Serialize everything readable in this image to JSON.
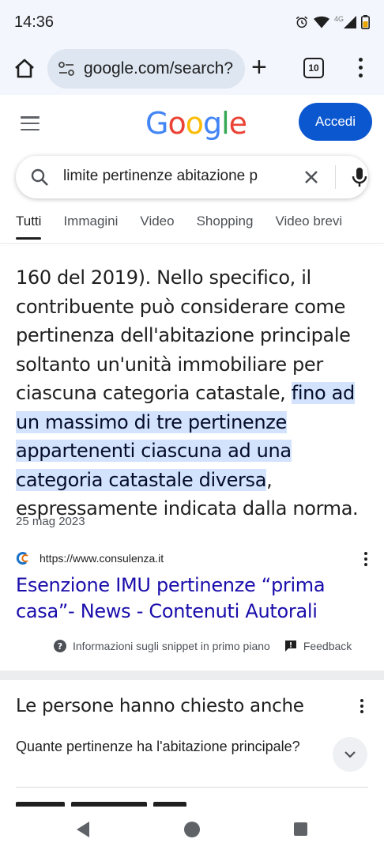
{
  "status_bar": {
    "time": "14:36",
    "network": "4G"
  },
  "browser": {
    "url": "google.com/search?",
    "tab_count": "10"
  },
  "header": {
    "logo": "Google",
    "signin_label": "Accedi"
  },
  "search": {
    "query": "limite pertinenze abitazione p"
  },
  "tabs": [
    "Tutti",
    "Immagini",
    "Video",
    "Shopping",
    "Video brevi"
  ],
  "snippet": {
    "text_before": "160 del 2019). Nello specifico, il contribuente può considerare come pertinenza dell'abitazione principale soltanto un'unità immobiliare per ciascuna categoria catastale, ",
    "highlight": "fino ad un massimo di tre pertinenze appartenenti ciascuna ad una categoria catastale diversa",
    "text_after": ", espressamente indicata dalla norma.",
    "date": "25 mag 2023",
    "source_url": "https://www.consulenza.it",
    "title": "Esenzione IMU pertinenze “prima casa”- News - Contenuti Autorali",
    "info_label": "Informazioni sugli snippet in primo piano",
    "feedback_label": "Feedback"
  },
  "paa": {
    "title": "Le persone hanno chiesto anche",
    "question": "Quante pertinenze ha l'abitazione principale?"
  },
  "colors": {
    "accent": "#0b57d0",
    "link": "#1a0dab",
    "highlight": "#d3e3fd"
  }
}
